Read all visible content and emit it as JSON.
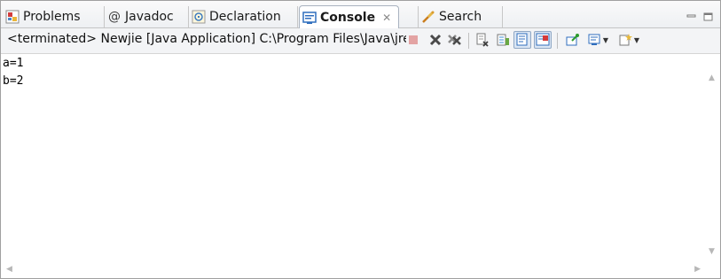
{
  "tabs": [
    {
      "label": "Problems",
      "icon": "problems-icon"
    },
    {
      "label": "Javadoc",
      "icon": "at-icon"
    },
    {
      "label": "Declaration",
      "icon": "declaration-icon"
    },
    {
      "label": "Console",
      "icon": "console-icon",
      "active": true,
      "close_glyph": "✕"
    },
    {
      "label": "Search",
      "icon": "search-icon"
    }
  ],
  "toolbar": {
    "status": "<terminated> Newjie [Java Application] C:\\Program Files\\Java\\jre\\bin\\javaw.exe"
  },
  "console": {
    "lines": [
      "a=1",
      "b=2"
    ]
  },
  "colors": {
    "accent": "#2f6ebd",
    "tab_border": "#a9b3c0",
    "background": "#ffffff"
  }
}
